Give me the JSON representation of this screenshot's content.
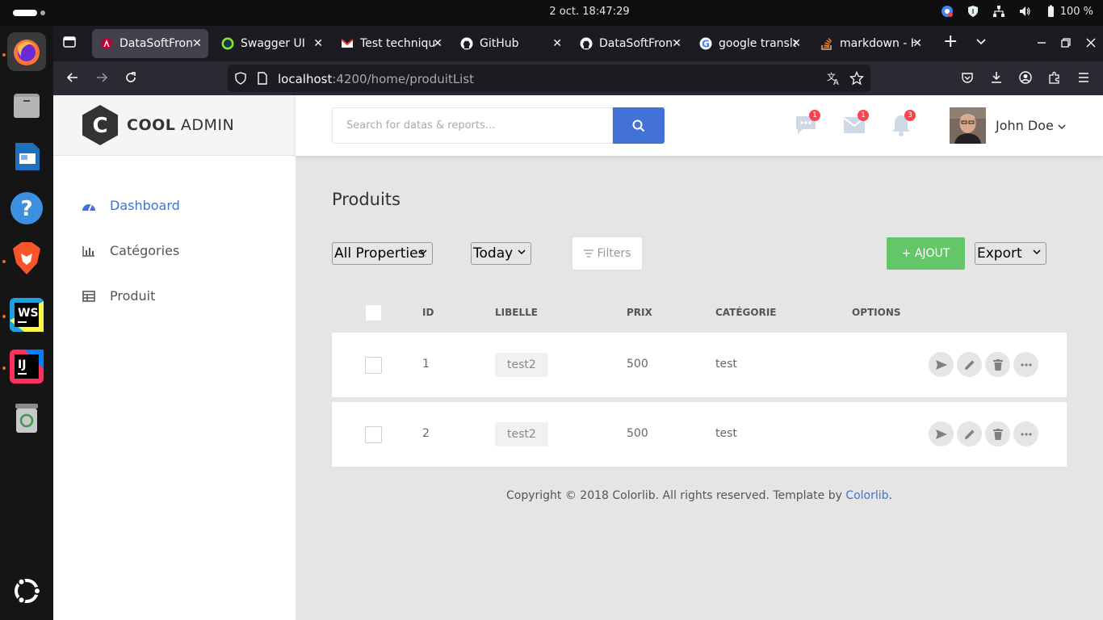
{
  "os": {
    "clock": "2 oct.  18:47:29",
    "battery": "100 %"
  },
  "dock": {
    "items": [
      "Firefox",
      "Fichiers",
      "LibreOffice Writer",
      "Aide",
      "Brave",
      "WebStorm",
      "IntelliJ IDEA",
      "Corbeille",
      "Afficher les applications"
    ]
  },
  "browser": {
    "tabs": [
      {
        "title": "DataSoftFront",
        "selected": true
      },
      {
        "title": "Swagger UI"
      },
      {
        "title": "Test technique"
      },
      {
        "title": "GitHub"
      },
      {
        "title": "DataSoftFront"
      },
      {
        "title": "google transla"
      },
      {
        "title": "markdown - H"
      }
    ],
    "url_host": "localhost",
    "url_path": ":4200/home/produitList"
  },
  "app": {
    "logo_bold": "COOL",
    "logo_light": "ADMIN",
    "logo_letter": "C",
    "menu": [
      {
        "label": "Dashboard",
        "icon": "dashboard-icon",
        "active": true
      },
      {
        "label": "Catégories",
        "icon": "bar-chart-icon"
      },
      {
        "label": "Produit",
        "icon": "table-icon"
      }
    ],
    "search_placeholder": "Search for datas & reports...",
    "notifications": {
      "messages": "1",
      "mail": "1",
      "alerts": "3"
    },
    "user_name": "John Doe"
  },
  "main": {
    "title": "Produits",
    "filter_property": "All Properties",
    "filter_date": "Today",
    "filters_label": "Filters",
    "add_label": "+ AJOUT",
    "export_label": "Export",
    "columns": [
      "ID",
      "LIBELLE",
      "PRIX",
      "CATÉGORIE",
      "OPTIONS"
    ],
    "rows": [
      {
        "id": "1",
        "libelle": "test2",
        "prix": "500",
        "categorie": "test"
      },
      {
        "id": "2",
        "libelle": "test2",
        "prix": "500",
        "categorie": "test"
      }
    ],
    "footer_text": "Copyright © 2018 Colorlib. All rights reserved. Template by ",
    "footer_link": "Colorlib",
    "footer_end": "."
  },
  "colors": {
    "accent": "#4272d7",
    "add_button": "#63c76a",
    "badge": "#fa4251",
    "page_bg": "#e5e5e5"
  }
}
